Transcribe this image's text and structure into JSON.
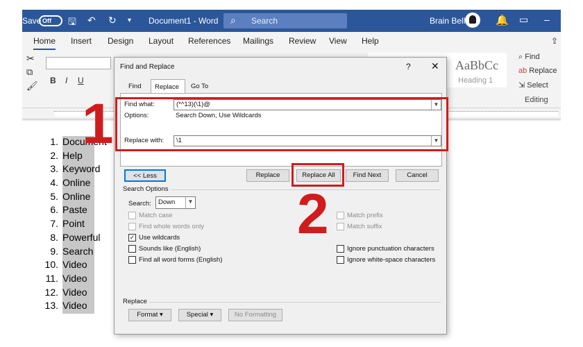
{
  "titlebar": {
    "autosave_label": "Save",
    "autosave_toggle": "Off",
    "document_title": "Document1 - Word",
    "search_placeholder": "Search",
    "user_name": "Brain Bell"
  },
  "ribbon_tabs": [
    "Home",
    "Insert",
    "Design",
    "Layout",
    "References",
    "Mailings",
    "Review",
    "View",
    "Help"
  ],
  "ribbon": {
    "bold": "B",
    "italic": "I",
    "underline": "U",
    "style_preview": "AaBbCc",
    "style_name": "Heading 1",
    "find_label": "Find",
    "replace_label": "Replace",
    "select_label": "Select",
    "editing_group": "Editing"
  },
  "document": {
    "list_items": [
      {
        "num": "1.",
        "text": "Document"
      },
      {
        "num": "2.",
        "text": "Help"
      },
      {
        "num": "3.",
        "text": "Keyword"
      },
      {
        "num": "4.",
        "text": "Online"
      },
      {
        "num": "5.",
        "text": "Online"
      },
      {
        "num": "6.",
        "text": "Paste"
      },
      {
        "num": "7.",
        "text": "Point"
      },
      {
        "num": "8.",
        "text": "Powerful"
      },
      {
        "num": "9.",
        "text": "Search"
      },
      {
        "num": "10.",
        "text": "Video"
      },
      {
        "num": "11.",
        "text": "Video"
      },
      {
        "num": "12.",
        "text": "Video"
      },
      {
        "num": "13.",
        "text": "Video"
      }
    ]
  },
  "dialog": {
    "title": "Find and Replace",
    "help": "?",
    "close": "✕",
    "tabs": [
      "Find",
      "Replace",
      "Go To"
    ],
    "find_what_label": "Find what:",
    "find_what_value": "(*^13)(\\1)@",
    "options_label": "Options:",
    "options_value": "Search Down, Use Wildcards",
    "replace_with_label": "Replace with:",
    "replace_with_value": "\\1",
    "less_button": "<< Less",
    "replace_button": "Replace",
    "replace_all_button": "Replace All",
    "find_next_button": "Find Next",
    "cancel_button": "Cancel",
    "search_options_label": "Search Options",
    "search_label": "Search:",
    "search_value": "Down",
    "checkboxes_left": [
      {
        "label": "Match case",
        "checked": false,
        "disabled": true
      },
      {
        "label": "Find whole words only",
        "checked": false,
        "disabled": true
      },
      {
        "label": "Use wildcards",
        "checked": true,
        "disabled": false
      },
      {
        "label": "Sounds like (English)",
        "checked": false,
        "disabled": false
      },
      {
        "label": "Find all word forms (English)",
        "checked": false,
        "disabled": false
      }
    ],
    "checkboxes_right": [
      {
        "label": "Match prefix",
        "checked": false,
        "disabled": true
      },
      {
        "label": "Match suffix",
        "checked": false,
        "disabled": true
      },
      {
        "label": "Ignore punctuation characters",
        "checked": false,
        "disabled": false
      },
      {
        "label": "Ignore white-space characters",
        "checked": false,
        "disabled": false
      }
    ],
    "replace_section_label": "Replace",
    "format_button": "Format ▾",
    "special_button": "Special ▾",
    "no_formatting_button": "No Formatting"
  },
  "annotations": {
    "step1": "1",
    "step2": "2",
    "highlight_color": "#d01c1c"
  },
  "colors": {
    "word_blue": "#2b579a",
    "selection_gray": "#c7c7c7"
  }
}
